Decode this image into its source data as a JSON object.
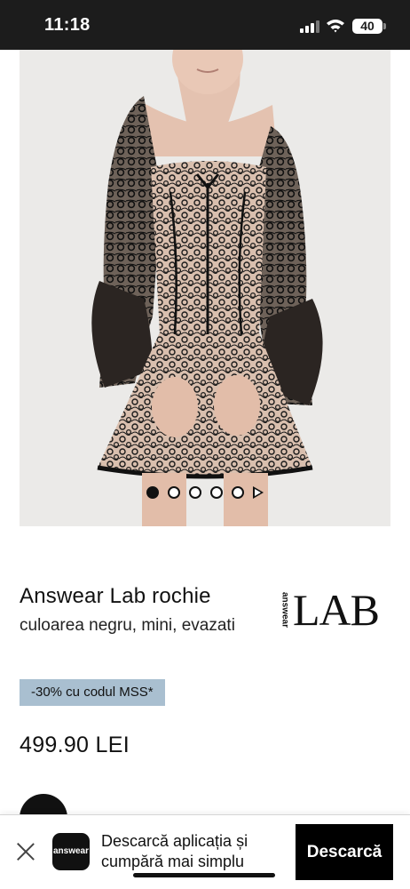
{
  "status_bar": {
    "time": "11:18",
    "battery": "40",
    "icons": [
      "signal-icon",
      "wifi-icon",
      "battery-icon"
    ]
  },
  "product": {
    "title": "Answear Lab rochie",
    "description": "culoarea negru, mini, evazati",
    "promo": "-30% cu codul MSS*",
    "price": "499.90 LEI",
    "image_alt": "black lace mini dress",
    "carousel": {
      "total_images": 5,
      "active_index": 0,
      "has_video": true
    }
  },
  "brand": {
    "small_label": "answear",
    "big_label": "LAB"
  },
  "app_banner": {
    "app_icon_label": "answear",
    "text": "Descarcă aplicația și cumpără mai simplu",
    "download_label": "Descarcă"
  }
}
